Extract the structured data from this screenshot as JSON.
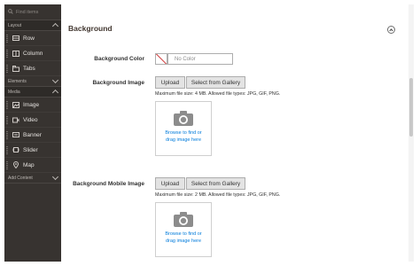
{
  "sidebar": {
    "search_placeholder": "Find items",
    "sections": {
      "layout": "Layout",
      "elements": "Elements",
      "media": "Media",
      "add_content": "Add Content"
    },
    "layout_items": [
      "Row",
      "Column",
      "Tabs"
    ],
    "media_items": [
      "Image",
      "Video",
      "Banner",
      "Slider",
      "Map"
    ]
  },
  "panel": {
    "title": "Background",
    "bg_color_label": "Background Color",
    "color_placeholder": "No Color",
    "bg_image_label": "Background Image",
    "upload_label": "Upload",
    "gallery_label": "Select from Gallery",
    "image_note": "Maximum file size: 4 MB. Allowed file types: JPG, GIF, PNG.",
    "drop_text_1": "Browse to find or",
    "drop_text_2": "drag image here",
    "bg_mobile_label": "Background Mobile Image",
    "mobile_upload_label": "Upload",
    "mobile_gallery_label": "Select from Gallery",
    "mobile_note": "Maximum file size: 2 MB. Allowed file types: JPG, GIF, PNG.",
    "mobile_drop_text_1": "Browse to find or",
    "mobile_drop_text_2": "drag image here"
  },
  "colors": {
    "sidebar_bg": "#373330",
    "link_blue": "#007bdb",
    "no_color_slash": "#d04040"
  }
}
